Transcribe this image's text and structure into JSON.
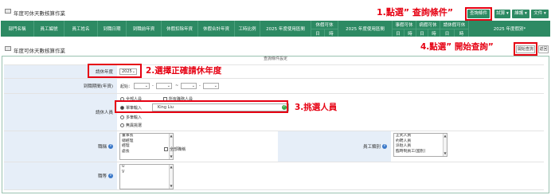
{
  "app": {
    "title": "年度可休天數核算作業",
    "subtitle": "年度可休天數核算作業"
  },
  "annotations": {
    "step1": "1.點選” 查詢條件”",
    "step2": "2.選擇正確請休年度",
    "step3": "3.挑選人員",
    "step4": "4.點選” 開始查詢”"
  },
  "toolbar": {
    "query": "查詢條件",
    "trial": "試算 ▾",
    "edit": "維護 ▾",
    "file": "文件 ▾"
  },
  "grid": {
    "columns": [
      "部門名稱",
      "員工編號",
      "員工姓名",
      "到職日期",
      "到職前年資",
      "休假扣除年資",
      "休假合計年資",
      "工時比例",
      "2025 年度使用區間",
      "休假可休",
      "2025 年度使用區間",
      "事假可休",
      "病假可休",
      "請休假可休",
      "2025 年度假別*"
    ],
    "sub": {
      "day": "日",
      "hour": "時"
    }
  },
  "actions": {
    "start": "開始查詢",
    "back": "返回"
  },
  "panel": {
    "title": "查詢條件設定"
  },
  "form": {
    "year": {
      "label": "請休年度",
      "value": "2025"
    },
    "period": {
      "label": "到職期間(年資)",
      "from": "起始：",
      "sep1": "-",
      "sep2": "-",
      "to": "~"
    },
    "person": {
      "label": "請休人員",
      "opt_all": "全部人員",
      "opt_dept": "所有職務人員",
      "opt_single": "單筆輸入",
      "single_value": "King Liu",
      "opt_multi": "多筆輸入",
      "opt_none": "無異挑選"
    },
    "title_field": {
      "label": "職稱",
      "options": [
        "董事長",
        "總經理",
        "經理",
        "處長"
      ],
      "all_label": "全部職稱"
    },
    "emp_type": {
      "label": "員工類別",
      "options": [
        "正式人員",
        "約聘人員",
        "派駐人員",
        "臨時制員工(國別)"
      ]
    },
    "rank": {
      "label": "職等",
      "options": [
        "U",
        "V"
      ]
    }
  }
}
